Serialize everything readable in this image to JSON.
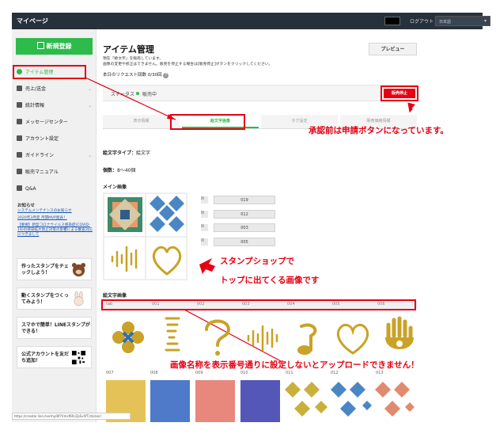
{
  "topbar": {
    "brand": "マイページ",
    "logout": "ログアウト",
    "language": "日本語"
  },
  "sidebar": {
    "new_button": "新規登録",
    "items": [
      {
        "label": "アイテム管理",
        "icon": "gear-icon"
      },
      {
        "label": "売上/送金",
        "icon": "coin-icon"
      },
      {
        "label": "統計情報",
        "icon": "chart-icon"
      },
      {
        "label": "メッセージセンター",
        "icon": "mail-icon"
      },
      {
        "label": "アカウント設定",
        "icon": "user-icon"
      },
      {
        "label": "ガイドライン",
        "icon": "book-icon"
      },
      {
        "label": "販売マニュアル",
        "icon": "document-icon"
      },
      {
        "label": "Q&A",
        "icon": "question-icon"
      }
    ],
    "news_title": "お知らせ",
    "news": [
      "システムメンテナンスのお知らせ",
      "2020年3月度 月間MVP発表！",
      "【重要】新型コロナウイルス感染症(COVID-19)の感染拡大防止対策の影響による審査対応につきまして"
    ],
    "promos": [
      {
        "text": "作ったスタンプをチェックしよう！"
      },
      {
        "text": "動くスタンプをつくってみよう！"
      },
      {
        "text": "スマホで簡単！LINEスタンプができる！"
      },
      {
        "text": "公式アカウントを友だち追加！"
      }
    ]
  },
  "main": {
    "title": "アイテム管理",
    "notice_1": "現在「絵文字」を販売しています。",
    "notice_2": "画像の変更や修正はできません。販売を停止する場合は[販売停止]ボタンをクリックしてください。",
    "request": "本日のリクエスト回数 0/30回",
    "preview_button": "プレビュー",
    "status_label": "ステータス",
    "status_value": "販売中",
    "stop_button": "販売停止",
    "tabs": [
      "表示情報",
      "絵文字画像",
      "タグ設定",
      "販売価格情報"
    ],
    "type_label": "絵文字タイプ：",
    "type_value": "絵文字",
    "count_label": "個数：",
    "count_value": "8〜40個",
    "main_image_label": "メイン画像",
    "main_image_rows": [
      "019",
      "012",
      "003",
      "005"
    ],
    "emoji_image_label": "絵文字画像",
    "numbers_row1": [
      "tab",
      "001",
      "002",
      "003",
      "004",
      "005",
      "006"
    ],
    "numbers_row2": [
      "007",
      "008",
      "009",
      "010",
      "011",
      "012",
      "013"
    ],
    "url": "https://creator.line.me/my/8f7Vmsf6RcZpSx5fT/sticker/"
  },
  "annotations": {
    "approval_note": "承認前は申請ボタンになっています。",
    "shop_note_1": "スタンプショップで",
    "shop_note_2": "トップに出てくる画像です",
    "naming_note": "画像名称を表示番号通りに設定しないとアップロードできません！"
  },
  "colors": {
    "accent": "#2dbb4c",
    "annotation": "#e60012",
    "topbar": "#27313c",
    "gold": "#c9a227"
  }
}
